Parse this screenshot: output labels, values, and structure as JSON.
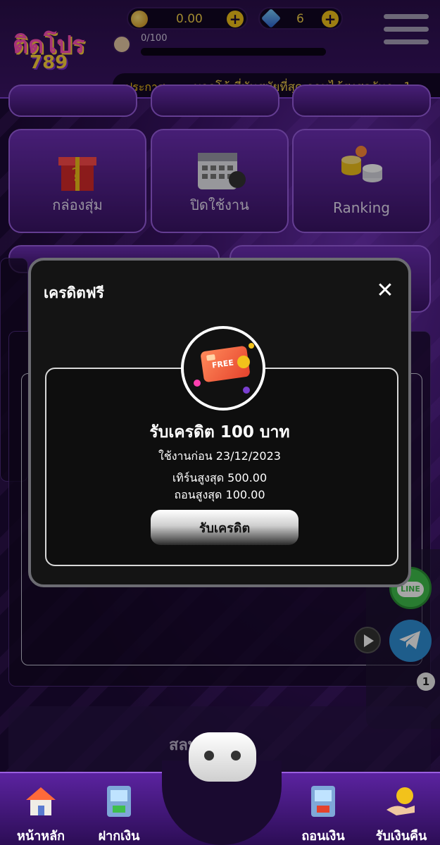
{
  "header": {
    "logo_line1": "ติดโปร",
    "logo_line2": "789",
    "coins": "0.00",
    "gems": "6",
    "level_progress": "0/100",
    "level_progress_fraction": 0.0,
    "announce_label": "ประกาศ :",
    "announce_text": "บออโต้ ที่ทันสมัยที่สุด ถอนได้สูงสุดวันละ 1"
  },
  "tiles": [
    {
      "label": "กล่องสุ่ม"
    },
    {
      "label": "ปิดใช้งาน"
    },
    {
      "label": "Ranking"
    }
  ],
  "modal": {
    "title": "เครดิตฟรี",
    "close": "✕",
    "badge_text": "FREE",
    "heading": "รับเครดิต 100 บาท",
    "use_before": "ใช้งานก่อน 23/12/2023",
    "max_turnover": "เทิร์นสูงสุด 500.00",
    "max_withdraw": "ถอนสูงสุด 100.00",
    "claim_button": "รับเครดิต"
  },
  "side": {
    "line_label": "LINE",
    "notification_count": "1"
  },
  "spin_label": "สลท่ ...อน",
  "bottom_nav": [
    {
      "label": "หน้าหลัก"
    },
    {
      "label": "ฝากเงิน"
    },
    {
      "label": "ถอนเงิน"
    },
    {
      "label": "รับเงินคืน"
    }
  ],
  "colors": {
    "accent_gold": "#f2c21b",
    "purple": "#6d2fb5",
    "modal_bg": "#141414"
  }
}
